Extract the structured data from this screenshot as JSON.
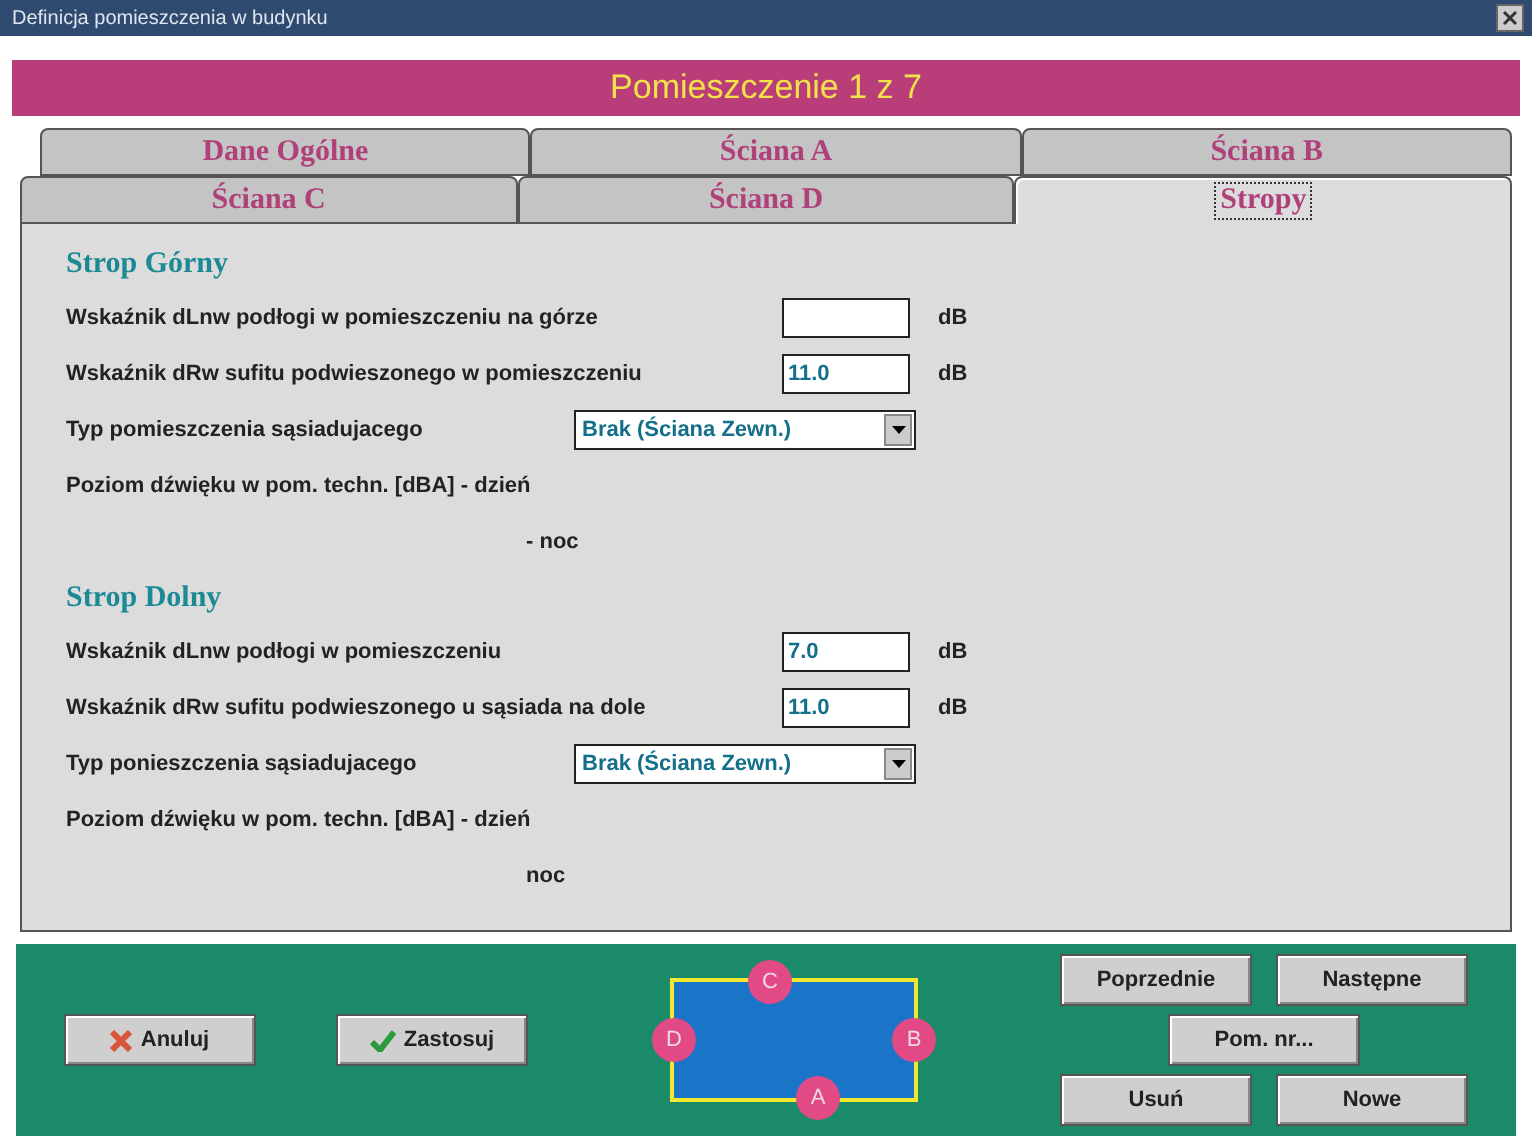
{
  "window": {
    "title": "Definicja pomieszczenia w budynku"
  },
  "banner": "Pomieszczenie 1 z 7",
  "tab_rows": [
    [
      {
        "label": "Dane Ogólne",
        "selected": false
      },
      {
        "label": "Ściana A",
        "selected": false
      },
      {
        "label": "Ściana B",
        "selected": false
      }
    ],
    [
      {
        "label": "Ściana C",
        "selected": false
      },
      {
        "label": "Ściana D",
        "selected": false
      },
      {
        "label": "Stropy",
        "selected": true
      }
    ]
  ],
  "sections": [
    {
      "heading": "Strop Górny",
      "rows": [
        {
          "kind": "input",
          "label": "Wskaźnik dLnw podłogi w pomieszczeniu na górze",
          "unit": "dB"
        },
        {
          "kind": "input",
          "label": "Wskaźnik dRw sufitu podwieszonego w pomieszczeniu",
          "value": "11.0",
          "unit": "dB"
        },
        {
          "kind": "select",
          "label": "Typ pomieszczenia sąsiadujacego",
          "value": "Brak (Ściana Zewn.)"
        },
        {
          "kind": "reading",
          "label": "Poziom dźwięku w pom. techn.  [dBA] - dzień"
        },
        {
          "kind": "subreading",
          "label": "- noc"
        }
      ]
    },
    {
      "heading": "Strop Dolny",
      "rows": [
        {
          "kind": "input",
          "label": "Wskaźnik dLnw podłogi w pomieszczeniu",
          "value": "7.0",
          "unit": "dB"
        },
        {
          "kind": "input",
          "label": "Wskaźnik dRw sufitu podwieszonego u sąsiada na dole",
          "value": "11.0",
          "unit": "dB"
        },
        {
          "kind": "select",
          "label": "Typ ponieszczenia sąsiadujacego",
          "value": "Brak (Ściana Zewn.)"
        },
        {
          "kind": "reading",
          "label": "Poziom dźwięku w pom. techn.  [dBA] - dzień"
        },
        {
          "kind": "subreading",
          "label": "noc"
        }
      ]
    }
  ],
  "actions": [
    {
      "kind": "cancel",
      "label": "Anuluj"
    },
    {
      "kind": "apply",
      "label": "Zastosuj"
    }
  ],
  "diagram": [
    {
      "kind": "top",
      "label": "C"
    },
    {
      "kind": "left",
      "label": "D"
    },
    {
      "kind": "right",
      "label": "B"
    },
    {
      "kind": "bottom",
      "label": "A"
    }
  ],
  "nav_buttons": [
    [
      "Poprzednie",
      "Następne"
    ],
    [
      "Pom. nr..."
    ],
    [
      "Usuń",
      "Nowe"
    ]
  ]
}
